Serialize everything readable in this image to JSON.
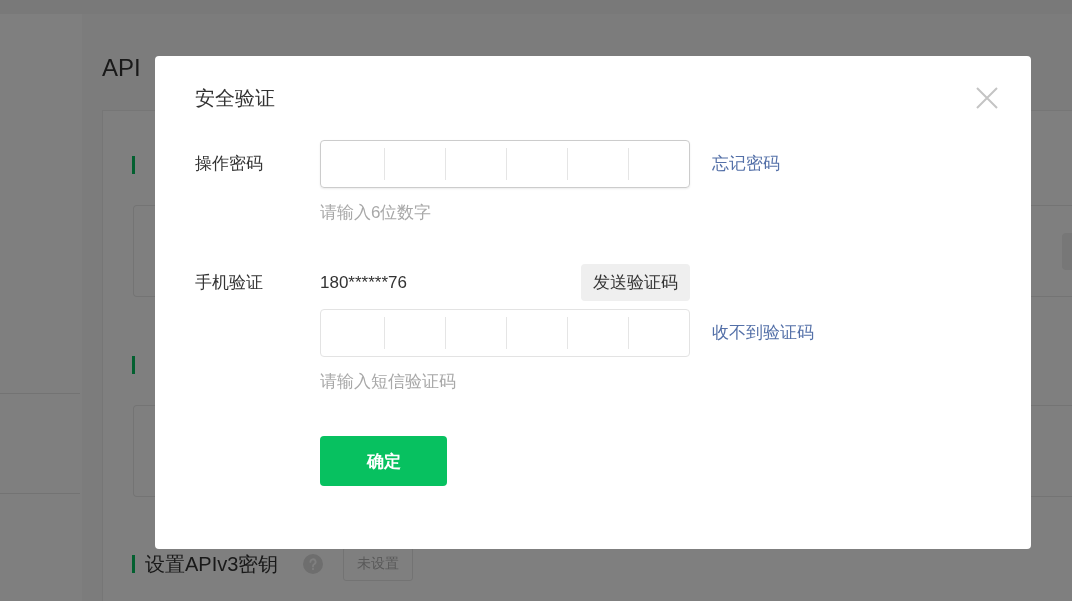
{
  "page": {
    "title": "API",
    "sections": [
      {
        "kind": "action_card"
      },
      {
        "kind": "card"
      },
      {
        "kind": "setting",
        "title": "设置APIv3密钥",
        "status": "未设置"
      }
    ]
  },
  "dialog": {
    "title": "安全验证",
    "password": {
      "label": "操作密码",
      "focused": true,
      "link": "忘记密码",
      "hint": "请输入6位数字"
    },
    "phone": {
      "label": "手机验证",
      "number": "180******76",
      "send_button": "发送验证码",
      "focused": false,
      "link": "收不到验证码",
      "hint": "请输入短信验证码"
    },
    "confirm_button": "确定"
  }
}
